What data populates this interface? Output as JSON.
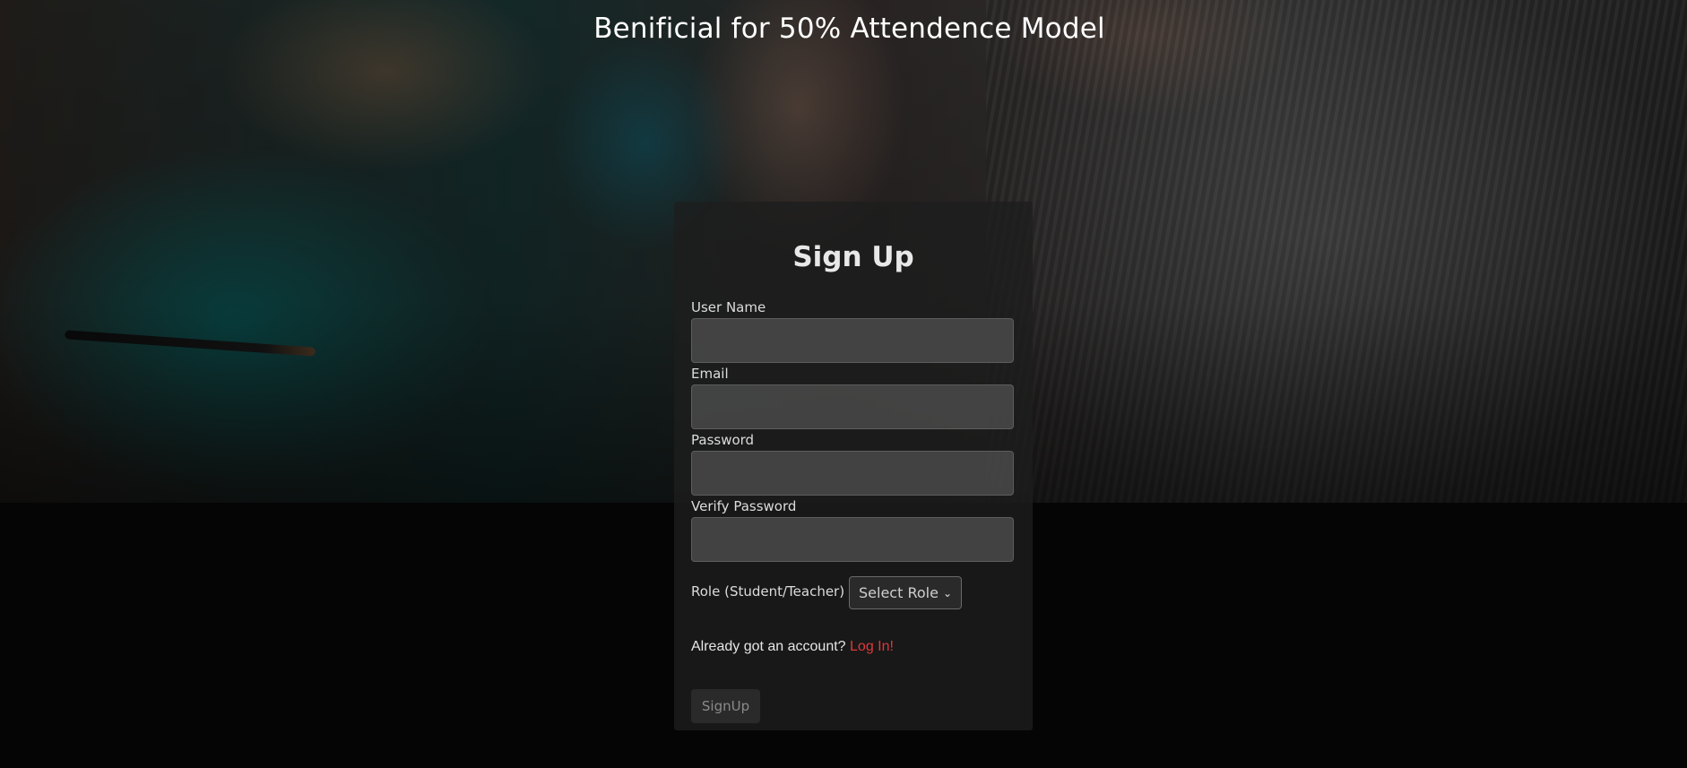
{
  "page": {
    "headline": "Benificial for 50% Attendence Model"
  },
  "form": {
    "title": "Sign Up",
    "fields": [
      {
        "label": "User Name",
        "value": "",
        "placeholder": ""
      },
      {
        "label": "Email",
        "value": "",
        "placeholder": ""
      },
      {
        "label": "Password",
        "value": "",
        "placeholder": ""
      },
      {
        "label": "Verify Password",
        "value": "",
        "placeholder": ""
      }
    ],
    "role": {
      "label": "Role (Student/Teacher)",
      "selected": "Select Role"
    },
    "login_prompt": "Already got an account?",
    "login_link": "Log In!",
    "submit_label": "SignUp"
  },
  "colors": {
    "link": "#e0373a",
    "card_bg": "#1e1e1e",
    "page_bg": "#050505"
  }
}
